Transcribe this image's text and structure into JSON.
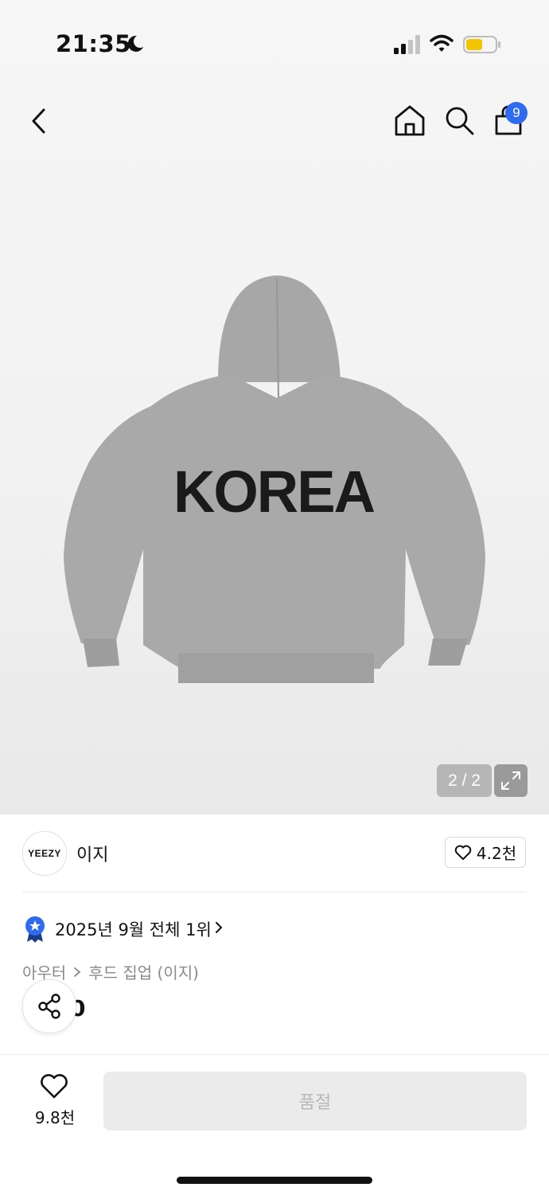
{
  "status_bar": {
    "time": "21:35"
  },
  "nav": {
    "cart_count": "9"
  },
  "product_image": {
    "print_text": "KOREA",
    "counter": "2 / 2",
    "garment_color": "#a9a9a9"
  },
  "brand": {
    "logo_text": "YEEZY",
    "name": "이지",
    "likes": "4.2천"
  },
  "ranking": {
    "text": "2025년 9월 전체 1위"
  },
  "breadcrumb": {
    "level1": "아우터",
    "level2": "후드 집업 (이지)"
  },
  "price": {
    "visible_text": "0"
  },
  "bottom_bar": {
    "like_count": "9.8천",
    "action_label": "품절"
  },
  "colors": {
    "accent_blue": "#2f6bf0",
    "battery_yellow": "#f5c400",
    "soldout_bg": "#ebebeb",
    "soldout_text": "#b8b8b8"
  },
  "icons": [
    "back-icon",
    "home-icon",
    "search-icon",
    "bag-icon",
    "expand-icon",
    "heart-icon",
    "rank-badge-icon",
    "share-icon"
  ]
}
